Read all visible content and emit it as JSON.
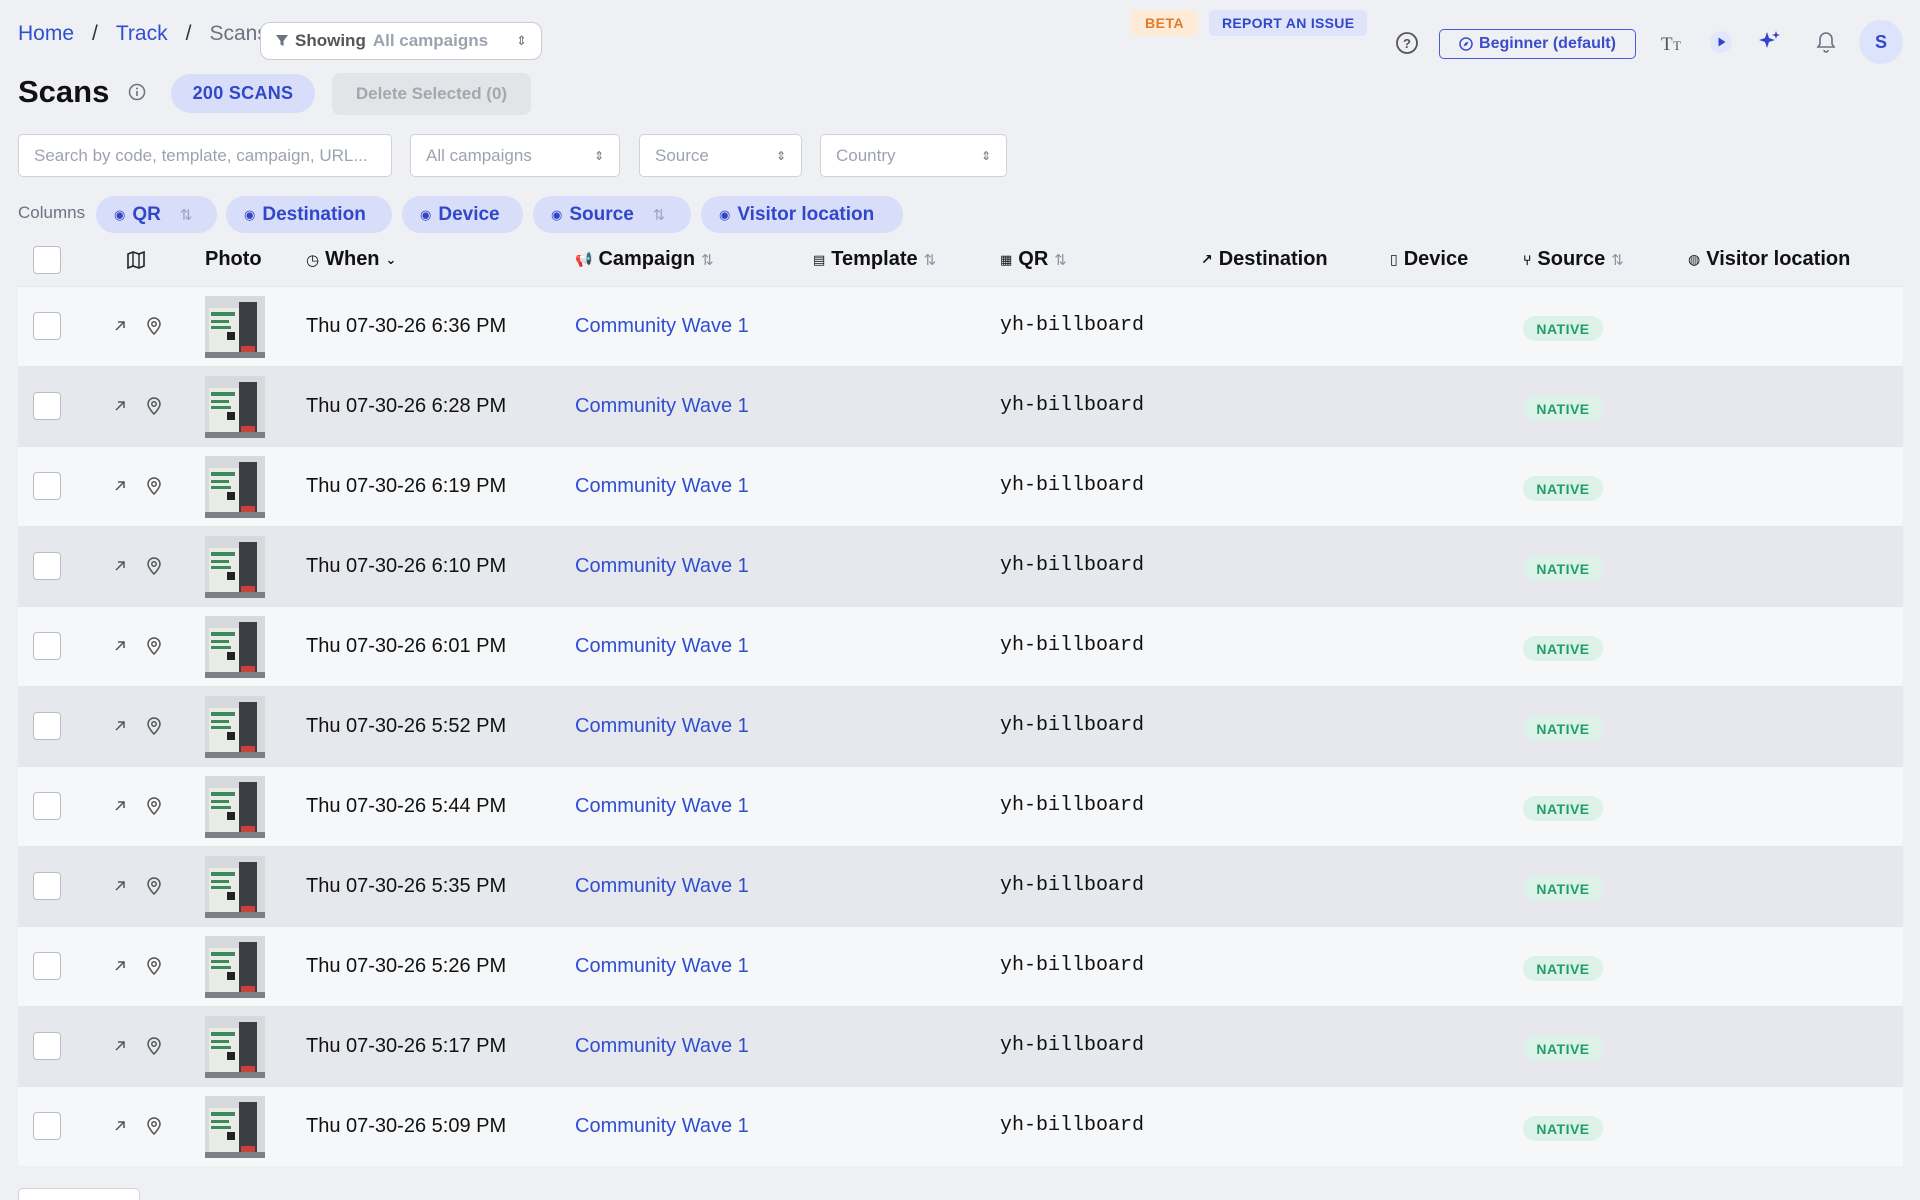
{
  "breadcrumb": {
    "home": "Home",
    "track": "Track",
    "current": "Scans",
    "sep": "/"
  },
  "showing": {
    "label": "Showing",
    "value": "All campaigns"
  },
  "header": {
    "beta": "BETA",
    "report": "REPORT AN ISSUE",
    "level": "Beginner (default)",
    "avatar": "S"
  },
  "page": {
    "title": "Scans",
    "count_pill": "200 SCANS",
    "delete_button": "Delete Selected (0)"
  },
  "filters": {
    "search_placeholder": "Search by code, template, campaign, URL...",
    "campaign": "All campaigns",
    "source": "Source",
    "country": "Country"
  },
  "columns": {
    "label": "Columns",
    "chips": [
      "QR",
      "Destination",
      "Device",
      "Source",
      "Visitor location"
    ]
  },
  "table": {
    "headers": {
      "photo": "Photo",
      "when": "When",
      "campaign": "Campaign",
      "template": "Template",
      "qr": "QR",
      "destination": "Destination",
      "device": "Device",
      "source": "Source",
      "visitor_location": "Visitor location"
    },
    "rows": [
      {
        "when": "Thu 07-30-26 6:36 PM",
        "campaign": "Community Wave 1",
        "qr": "yh-billboard",
        "source": "NATIVE"
      },
      {
        "when": "Thu 07-30-26 6:28 PM",
        "campaign": "Community Wave 1",
        "qr": "yh-billboard",
        "source": "NATIVE"
      },
      {
        "when": "Thu 07-30-26 6:19 PM",
        "campaign": "Community Wave 1",
        "qr": "yh-billboard",
        "source": "NATIVE"
      },
      {
        "when": "Thu 07-30-26 6:10 PM",
        "campaign": "Community Wave 1",
        "qr": "yh-billboard",
        "source": "NATIVE"
      },
      {
        "when": "Thu 07-30-26 6:01 PM",
        "campaign": "Community Wave 1",
        "qr": "yh-billboard",
        "source": "NATIVE"
      },
      {
        "when": "Thu 07-30-26 5:52 PM",
        "campaign": "Community Wave 1",
        "qr": "yh-billboard",
        "source": "NATIVE"
      },
      {
        "when": "Thu 07-30-26 5:44 PM",
        "campaign": "Community Wave 1",
        "qr": "yh-billboard",
        "source": "NATIVE"
      },
      {
        "when": "Thu 07-30-26 5:35 PM",
        "campaign": "Community Wave 1",
        "qr": "yh-billboard",
        "source": "NATIVE"
      },
      {
        "when": "Thu 07-30-26 5:26 PM",
        "campaign": "Community Wave 1",
        "qr": "yh-billboard",
        "source": "NATIVE"
      },
      {
        "when": "Thu 07-30-26 5:17 PM",
        "campaign": "Community Wave 1",
        "qr": "yh-billboard",
        "source": "NATIVE"
      },
      {
        "when": "Thu 07-30-26 5:09 PM",
        "campaign": "Community Wave 1",
        "qr": "yh-billboard",
        "source": "NATIVE"
      }
    ]
  },
  "colors": {
    "accent": "#3147c9",
    "link": "#2f4fd0",
    "native_bg": "#dcf1e8",
    "native_text": "#1f9d6b"
  }
}
